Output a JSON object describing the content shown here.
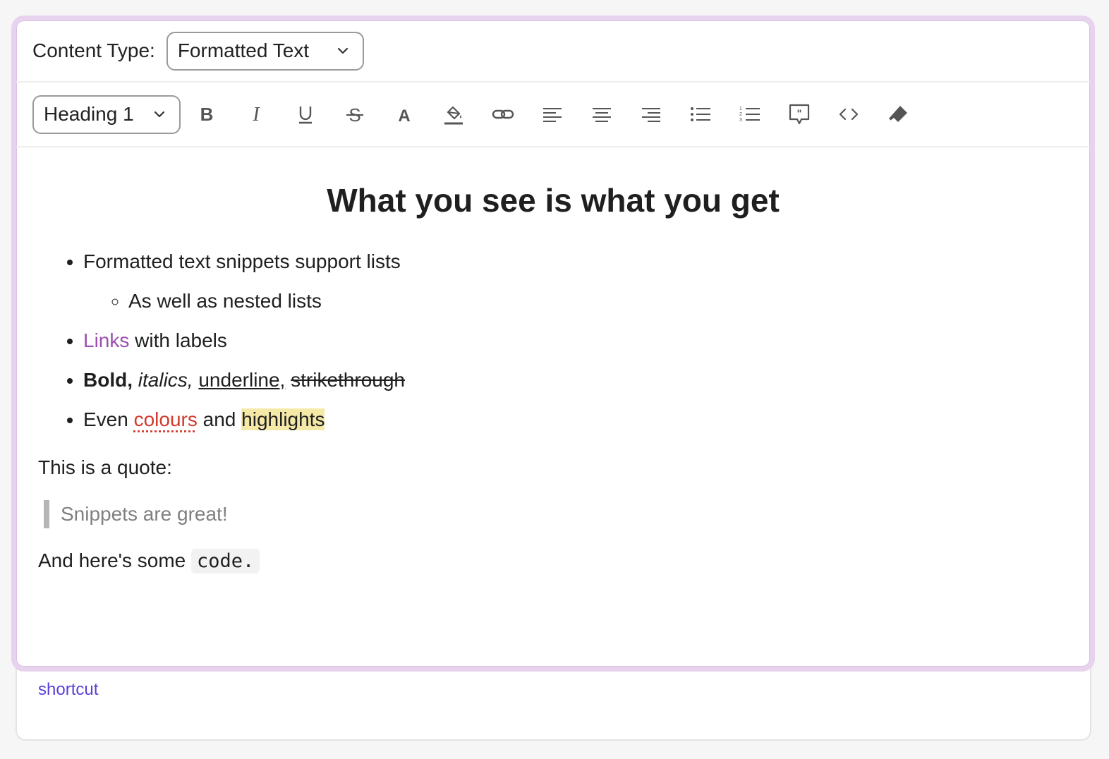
{
  "content_type": {
    "label": "Content Type:",
    "value": "Formatted Text"
  },
  "toolbar": {
    "block_style": "Heading 1",
    "buttons": [
      "bold-icon",
      "italic-icon",
      "underline-icon",
      "strikethrough-icon",
      "text-color-icon",
      "highlight-icon",
      "link-icon",
      "align-left-icon",
      "align-center-icon",
      "align-right-icon",
      "bullet-list-icon",
      "numbered-list-icon",
      "quote-icon",
      "code-icon",
      "clear-format-icon"
    ]
  },
  "document": {
    "heading": "What you see is what you get",
    "list": {
      "item1": "Formatted text snippets support lists",
      "nested1": "As well as nested lists",
      "item2_link": "Links",
      "item2_rest": " with labels",
      "item3_bold": "Bold,",
      "item3_italic": "italics,",
      "item3_underline": "underline,",
      "item3_strike": "strikethrough",
      "item4_pre": "Even ",
      "item4_color": "colours",
      "item4_mid": " and ",
      "item4_highlight": "highlights"
    },
    "para_quote_intro": "This is a quote:",
    "quote": "Snippets are great!",
    "para_code_pre": "And here's some ",
    "code": "code."
  },
  "footer": {
    "shortcut_label": "shortcut"
  },
  "colors": {
    "accent": "#9b4fb0",
    "border_focus": "#e7d3ee",
    "link_footer": "#5b3fd6",
    "red_text": "#d23a2c",
    "highlight": "#f5e9a8"
  }
}
